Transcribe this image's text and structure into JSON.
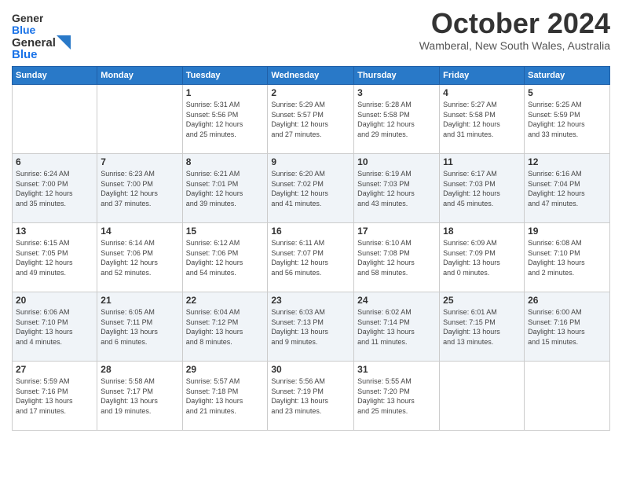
{
  "logo": {
    "line1": "General",
    "line2": "Blue"
  },
  "title": "October 2024",
  "location": "Wamberal, New South Wales, Australia",
  "days_of_week": [
    "Sunday",
    "Monday",
    "Tuesday",
    "Wednesday",
    "Thursday",
    "Friday",
    "Saturday"
  ],
  "weeks": [
    [
      {
        "day": "",
        "info": ""
      },
      {
        "day": "",
        "info": ""
      },
      {
        "day": "1",
        "info": "Sunrise: 5:31 AM\nSunset: 5:56 PM\nDaylight: 12 hours\nand 25 minutes."
      },
      {
        "day": "2",
        "info": "Sunrise: 5:29 AM\nSunset: 5:57 PM\nDaylight: 12 hours\nand 27 minutes."
      },
      {
        "day": "3",
        "info": "Sunrise: 5:28 AM\nSunset: 5:58 PM\nDaylight: 12 hours\nand 29 minutes."
      },
      {
        "day": "4",
        "info": "Sunrise: 5:27 AM\nSunset: 5:58 PM\nDaylight: 12 hours\nand 31 minutes."
      },
      {
        "day": "5",
        "info": "Sunrise: 5:25 AM\nSunset: 5:59 PM\nDaylight: 12 hours\nand 33 minutes."
      }
    ],
    [
      {
        "day": "6",
        "info": "Sunrise: 6:24 AM\nSunset: 7:00 PM\nDaylight: 12 hours\nand 35 minutes."
      },
      {
        "day": "7",
        "info": "Sunrise: 6:23 AM\nSunset: 7:00 PM\nDaylight: 12 hours\nand 37 minutes."
      },
      {
        "day": "8",
        "info": "Sunrise: 6:21 AM\nSunset: 7:01 PM\nDaylight: 12 hours\nand 39 minutes."
      },
      {
        "day": "9",
        "info": "Sunrise: 6:20 AM\nSunset: 7:02 PM\nDaylight: 12 hours\nand 41 minutes."
      },
      {
        "day": "10",
        "info": "Sunrise: 6:19 AM\nSunset: 7:03 PM\nDaylight: 12 hours\nand 43 minutes."
      },
      {
        "day": "11",
        "info": "Sunrise: 6:17 AM\nSunset: 7:03 PM\nDaylight: 12 hours\nand 45 minutes."
      },
      {
        "day": "12",
        "info": "Sunrise: 6:16 AM\nSunset: 7:04 PM\nDaylight: 12 hours\nand 47 minutes."
      }
    ],
    [
      {
        "day": "13",
        "info": "Sunrise: 6:15 AM\nSunset: 7:05 PM\nDaylight: 12 hours\nand 49 minutes."
      },
      {
        "day": "14",
        "info": "Sunrise: 6:14 AM\nSunset: 7:06 PM\nDaylight: 12 hours\nand 52 minutes."
      },
      {
        "day": "15",
        "info": "Sunrise: 6:12 AM\nSunset: 7:06 PM\nDaylight: 12 hours\nand 54 minutes."
      },
      {
        "day": "16",
        "info": "Sunrise: 6:11 AM\nSunset: 7:07 PM\nDaylight: 12 hours\nand 56 minutes."
      },
      {
        "day": "17",
        "info": "Sunrise: 6:10 AM\nSunset: 7:08 PM\nDaylight: 12 hours\nand 58 minutes."
      },
      {
        "day": "18",
        "info": "Sunrise: 6:09 AM\nSunset: 7:09 PM\nDaylight: 13 hours\nand 0 minutes."
      },
      {
        "day": "19",
        "info": "Sunrise: 6:08 AM\nSunset: 7:10 PM\nDaylight: 13 hours\nand 2 minutes."
      }
    ],
    [
      {
        "day": "20",
        "info": "Sunrise: 6:06 AM\nSunset: 7:10 PM\nDaylight: 13 hours\nand 4 minutes."
      },
      {
        "day": "21",
        "info": "Sunrise: 6:05 AM\nSunset: 7:11 PM\nDaylight: 13 hours\nand 6 minutes."
      },
      {
        "day": "22",
        "info": "Sunrise: 6:04 AM\nSunset: 7:12 PM\nDaylight: 13 hours\nand 8 minutes."
      },
      {
        "day": "23",
        "info": "Sunrise: 6:03 AM\nSunset: 7:13 PM\nDaylight: 13 hours\nand 9 minutes."
      },
      {
        "day": "24",
        "info": "Sunrise: 6:02 AM\nSunset: 7:14 PM\nDaylight: 13 hours\nand 11 minutes."
      },
      {
        "day": "25",
        "info": "Sunrise: 6:01 AM\nSunset: 7:15 PM\nDaylight: 13 hours\nand 13 minutes."
      },
      {
        "day": "26",
        "info": "Sunrise: 6:00 AM\nSunset: 7:16 PM\nDaylight: 13 hours\nand 15 minutes."
      }
    ],
    [
      {
        "day": "27",
        "info": "Sunrise: 5:59 AM\nSunset: 7:16 PM\nDaylight: 13 hours\nand 17 minutes."
      },
      {
        "day": "28",
        "info": "Sunrise: 5:58 AM\nSunset: 7:17 PM\nDaylight: 13 hours\nand 19 minutes."
      },
      {
        "day": "29",
        "info": "Sunrise: 5:57 AM\nSunset: 7:18 PM\nDaylight: 13 hours\nand 21 minutes."
      },
      {
        "day": "30",
        "info": "Sunrise: 5:56 AM\nSunset: 7:19 PM\nDaylight: 13 hours\nand 23 minutes."
      },
      {
        "day": "31",
        "info": "Sunrise: 5:55 AM\nSunset: 7:20 PM\nDaylight: 13 hours\nand 25 minutes."
      },
      {
        "day": "",
        "info": ""
      },
      {
        "day": "",
        "info": ""
      }
    ]
  ]
}
